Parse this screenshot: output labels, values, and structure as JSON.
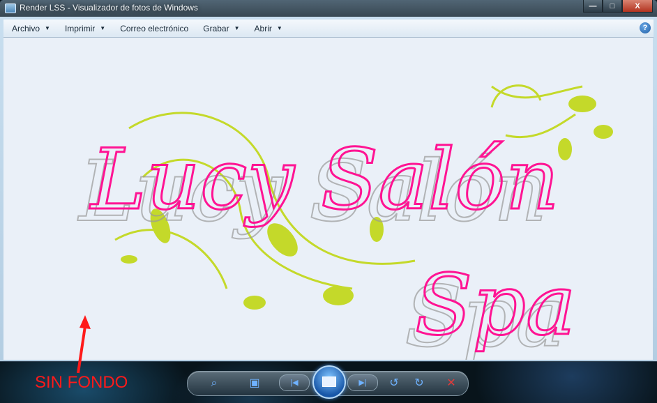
{
  "window": {
    "title": "Render LSS - Visualizador de fotos de Windows",
    "buttons": {
      "minimize": "—",
      "maximize": "□",
      "close": "X"
    }
  },
  "menubar": {
    "items": [
      {
        "label": "Archivo",
        "has_dropdown": true
      },
      {
        "label": "Imprimir",
        "has_dropdown": true
      },
      {
        "label": "Correo electrónico",
        "has_dropdown": false
      },
      {
        "label": "Grabar",
        "has_dropdown": true
      },
      {
        "label": "Abrir",
        "has_dropdown": true
      }
    ],
    "help_label": "?"
  },
  "image": {
    "line1": "Lucy Salón",
    "line2": "Spa",
    "text_color": "#ff1493",
    "swirl_color": "#c4d92a"
  },
  "controls": {
    "icons": [
      "zoom-icon",
      "actual-size-icon",
      "previous-icon",
      "slideshow-icon",
      "next-icon",
      "rotate-left-icon",
      "rotate-right-icon",
      "delete-icon"
    ],
    "accent": "#6fb2ff",
    "delete_color": "#e33b3b"
  },
  "annotation": {
    "text": "SIN FONDO",
    "color": "#ff1a1a"
  }
}
